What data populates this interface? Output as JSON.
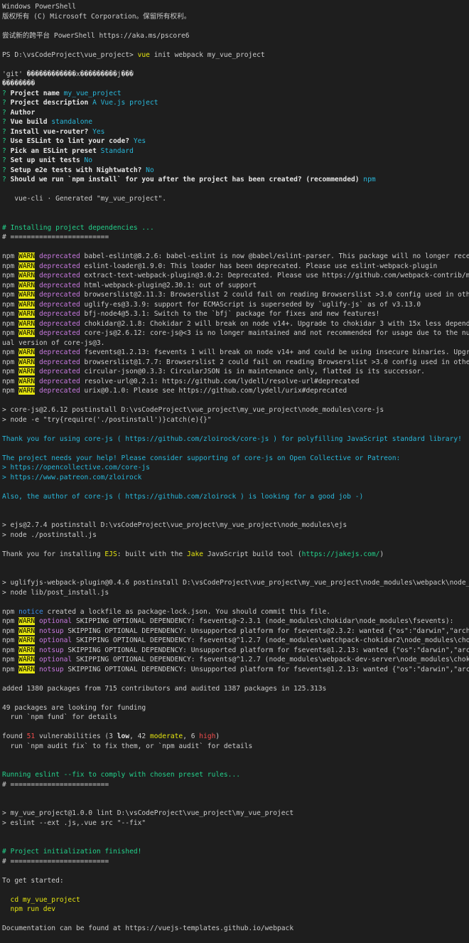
{
  "lines": [
    [
      {
        "t": "Windows PowerShell"
      }
    ],
    [
      {
        "t": "版权所有 (C) Microsoft Corporation。保留所有权利。"
      }
    ],
    [],
    [
      {
        "t": "尝试新的跨平台 PowerShell https://aka.ms/pscore6"
      }
    ],
    [],
    [
      {
        "t": "PS D:\\vsCodeProject\\vue_project> "
      },
      {
        "t": "vue",
        "c": "yellow"
      },
      {
        "t": " init webpack my_vue_project"
      }
    ],
    [],
    [
      {
        "t": "'git' ������������x���������j���"
      }
    ],
    [
      {
        "t": "��������"
      }
    ],
    [
      {
        "t": "? ",
        "c": "green"
      },
      {
        "t": "Project name ",
        "c": "bold"
      },
      {
        "t": "my_vue_project",
        "c": "cyan"
      }
    ],
    [
      {
        "t": "? ",
        "c": "green"
      },
      {
        "t": "Project description ",
        "c": "bold"
      },
      {
        "t": "A Vue.js project",
        "c": "cyan"
      }
    ],
    [
      {
        "t": "? ",
        "c": "green"
      },
      {
        "t": "Author",
        "c": "bold"
      }
    ],
    [
      {
        "t": "? ",
        "c": "green"
      },
      {
        "t": "Vue build ",
        "c": "bold"
      },
      {
        "t": "standalone",
        "c": "cyan"
      }
    ],
    [
      {
        "t": "? ",
        "c": "green"
      },
      {
        "t": "Install vue-router? ",
        "c": "bold"
      },
      {
        "t": "Yes",
        "c": "cyan"
      }
    ],
    [
      {
        "t": "? ",
        "c": "green"
      },
      {
        "t": "Use ESLint to lint your code? ",
        "c": "bold"
      },
      {
        "t": "Yes",
        "c": "cyan"
      }
    ],
    [
      {
        "t": "? ",
        "c": "green"
      },
      {
        "t": "Pick an ESLint preset ",
        "c": "bold"
      },
      {
        "t": "Standard",
        "c": "cyan"
      }
    ],
    [
      {
        "t": "? ",
        "c": "green"
      },
      {
        "t": "Set up unit tests ",
        "c": "bold"
      },
      {
        "t": "No",
        "c": "cyan"
      }
    ],
    [
      {
        "t": "? ",
        "c": "green"
      },
      {
        "t": "Setup e2e tests with Nightwatch? ",
        "c": "bold"
      },
      {
        "t": "No",
        "c": "cyan"
      }
    ],
    [
      {
        "t": "? ",
        "c": "green"
      },
      {
        "t": "Should we run `npm install` for you after the project has been created? (recommended) ",
        "c": "bold"
      },
      {
        "t": "npm",
        "c": "cyan"
      }
    ],
    [],
    [
      {
        "t": "   vue-cli · Generated \"my_vue_project\"."
      }
    ],
    [],
    [],
    [
      {
        "t": "# ",
        "c": "green"
      },
      {
        "t": "Installing project dependencies ...",
        "c": "green"
      }
    ],
    [
      {
        "t": "# ========================",
        "c": "gray"
      }
    ],
    [],
    [
      {
        "t": "npm "
      },
      {
        "t": "WARN",
        "c": "warn"
      },
      {
        "t": " "
      },
      {
        "t": "deprecated",
        "c": "magenta"
      },
      {
        "t": " babel-eslint@8.2.6: babel-eslint is now @babel/eslint-parser. This package will no longer receive u"
      }
    ],
    [
      {
        "t": "npm "
      },
      {
        "t": "WARN",
        "c": "warn"
      },
      {
        "t": " "
      },
      {
        "t": "deprecated",
        "c": "magenta"
      },
      {
        "t": " eslint-loader@1.9.0: This loader has been deprecated. Please use eslint-webpack-plugin"
      }
    ],
    [
      {
        "t": "npm "
      },
      {
        "t": "WARN",
        "c": "warn"
      },
      {
        "t": " "
      },
      {
        "t": "deprecated",
        "c": "magenta"
      },
      {
        "t": " extract-text-webpack-plugin@3.0.2: Deprecated. Please use https://github.com/webpack-contrib/mini-c"
      }
    ],
    [
      {
        "t": "npm "
      },
      {
        "t": "WARN",
        "c": "warn"
      },
      {
        "t": " "
      },
      {
        "t": "deprecated",
        "c": "magenta"
      },
      {
        "t": " html-webpack-plugin@2.30.1: out of support"
      }
    ],
    [
      {
        "t": "npm "
      },
      {
        "t": "WARN",
        "c": "warn"
      },
      {
        "t": " "
      },
      {
        "t": "deprecated",
        "c": "magenta"
      },
      {
        "t": " browserslist@2.11.3: Browserslist 2 could fail on reading Browserslist >3.0 config used in other to"
      }
    ],
    [
      {
        "t": "npm "
      },
      {
        "t": "WARN",
        "c": "warn"
      },
      {
        "t": " "
      },
      {
        "t": "deprecated",
        "c": "magenta"
      },
      {
        "t": " uglify-es@3.3.9: support for ECMAScript is superseded by `uglify-js` as of v3.13.0"
      }
    ],
    [
      {
        "t": "npm "
      },
      {
        "t": "WARN",
        "c": "warn"
      },
      {
        "t": " "
      },
      {
        "t": "deprecated",
        "c": "magenta"
      },
      {
        "t": " bfj-node4@5.3.1: Switch to the `bfj` package for fixes and new features!"
      }
    ],
    [
      {
        "t": "npm "
      },
      {
        "t": "WARN",
        "c": "warn"
      },
      {
        "t": " "
      },
      {
        "t": "deprecated",
        "c": "magenta"
      },
      {
        "t": " chokidar@2.1.8: Chokidar 2 will break on node v14+. Upgrade to chokidar 3 with 15x less dependencie"
      }
    ],
    [
      {
        "t": "npm "
      },
      {
        "t": "WARN",
        "c": "warn"
      },
      {
        "t": " "
      },
      {
        "t": "deprecated",
        "c": "magenta"
      },
      {
        "t": " core-js@2.6.12: core-js@<3 is no longer maintained and not recommended for usage due to the number"
      }
    ],
    [
      {
        "t": "ual version of core-js@3."
      }
    ],
    [
      {
        "t": "npm "
      },
      {
        "t": "WARN",
        "c": "warn"
      },
      {
        "t": " "
      },
      {
        "t": "deprecated",
        "c": "magenta"
      },
      {
        "t": " fsevents@1.2.13: fsevents 1 will break on node v14+ and could be using insecure binaries. Upgrade t"
      }
    ],
    [
      {
        "t": "npm "
      },
      {
        "t": "WARN",
        "c": "warn"
      },
      {
        "t": " "
      },
      {
        "t": "deprecated",
        "c": "magenta"
      },
      {
        "t": " browserslist@1.7.7: Browserslist 2 could fail on reading Browserslist >3.0 config used in other too"
      }
    ],
    [
      {
        "t": "npm "
      },
      {
        "t": "WARN",
        "c": "warn"
      },
      {
        "t": " "
      },
      {
        "t": "deprecated",
        "c": "magenta"
      },
      {
        "t": " circular-json@0.3.3: CircularJSON is in maintenance only, flatted is its successor."
      }
    ],
    [
      {
        "t": "npm "
      },
      {
        "t": "WARN",
        "c": "warn"
      },
      {
        "t": " "
      },
      {
        "t": "deprecated",
        "c": "magenta"
      },
      {
        "t": " resolve-url@0.2.1: https://github.com/lydell/resolve-url#deprecated"
      }
    ],
    [
      {
        "t": "npm "
      },
      {
        "t": "WARN",
        "c": "warn"
      },
      {
        "t": " "
      },
      {
        "t": "deprecated",
        "c": "magenta"
      },
      {
        "t": " urix@0.1.0: Please see https://github.com/lydell/urix#deprecated"
      }
    ],
    [],
    [
      {
        "t": "> core-js@2.6.12 postinstall D:\\vsCodeProject\\vue_project\\my_vue_project\\node_modules\\core-js"
      }
    ],
    [
      {
        "t": "> node -e \"try{require('./postinstall')}catch(e){}\""
      }
    ],
    [],
    [
      {
        "t": "Thank you for using core-js ( https://github.com/zloirock/core-js ) for polyfilling JavaScript standard library!",
        "c": "cyan"
      }
    ],
    [],
    [
      {
        "t": "The project needs your help! Please consider supporting of core-js on Open Collective or Patreon:",
        "c": "cyan"
      }
    ],
    [
      {
        "t": "> https://opencollective.com/core-js",
        "c": "cyan"
      }
    ],
    [
      {
        "t": "> https://www.patreon.com/zloirock",
        "c": "cyan"
      }
    ],
    [],
    [
      {
        "t": "Also, the author of core-js ( https://github.com/zloirock ) is looking for a good job -)",
        "c": "cyan"
      }
    ],
    [],
    [],
    [
      {
        "t": "> ejs@2.7.4 postinstall D:\\vsCodeProject\\vue_project\\my_vue_project\\node_modules\\ejs"
      }
    ],
    [
      {
        "t": "> node ./postinstall.js"
      }
    ],
    [],
    [
      {
        "t": "Thank you for installing "
      },
      {
        "t": "EJS",
        "c": "yellow"
      },
      {
        "t": ": built with the "
      },
      {
        "t": "Jake",
        "c": "yellow"
      },
      {
        "t": " JavaScript build tool ("
      },
      {
        "t": "https://jakejs.com/",
        "c": "green"
      },
      {
        "t": ")"
      }
    ],
    [],
    [],
    [
      {
        "t": "> uglifyjs-webpack-plugin@0.4.6 postinstall D:\\vsCodeProject\\vue_project\\my_vue_project\\node_modules\\webpack\\node_modu"
      }
    ],
    [
      {
        "t": "> node lib/post_install.js"
      }
    ],
    [],
    [
      {
        "t": "npm "
      },
      {
        "t": "notice",
        "c": "notice-blue"
      },
      {
        "t": " created a lockfile as package-lock.json. You should commit this file."
      }
    ],
    [
      {
        "t": "npm "
      },
      {
        "t": "WARN",
        "c": "warn"
      },
      {
        "t": " "
      },
      {
        "t": "optional",
        "c": "magenta"
      },
      {
        "t": " SKIPPING OPTIONAL DEPENDENCY: fsevents@~2.3.1 (node_modules\\chokidar\\node_modules\\fsevents):"
      }
    ],
    [
      {
        "t": "npm "
      },
      {
        "t": "WARN",
        "c": "warn"
      },
      {
        "t": " "
      },
      {
        "t": "notsup",
        "c": "magenta"
      },
      {
        "t": " SKIPPING OPTIONAL DEPENDENCY: Unsupported platform for fsevents@2.3.2: wanted {\"os\":\"darwin\",\"arch\":\"an"
      }
    ],
    [
      {
        "t": "npm "
      },
      {
        "t": "WARN",
        "c": "warn"
      },
      {
        "t": " "
      },
      {
        "t": "optional",
        "c": "magenta"
      },
      {
        "t": " SKIPPING OPTIONAL DEPENDENCY: fsevents@^1.2.7 (node_modules\\watchpack-chokidar2\\node_modules\\chokidar"
      }
    ],
    [
      {
        "t": "npm "
      },
      {
        "t": "WARN",
        "c": "warn"
      },
      {
        "t": " "
      },
      {
        "t": "notsup",
        "c": "magenta"
      },
      {
        "t": " SKIPPING OPTIONAL DEPENDENCY: Unsupported platform for fsevents@1.2.13: wanted {\"os\":\"darwin\",\"arch\":\"a"
      }
    ],
    [
      {
        "t": "npm "
      },
      {
        "t": "WARN",
        "c": "warn"
      },
      {
        "t": " "
      },
      {
        "t": "optional",
        "c": "magenta"
      },
      {
        "t": " SKIPPING OPTIONAL DEPENDENCY: fsevents@^1.2.7 (node_modules\\webpack-dev-server\\node_modules\\chokidar\\"
      }
    ],
    [
      {
        "t": "npm "
      },
      {
        "t": "WARN",
        "c": "warn"
      },
      {
        "t": " "
      },
      {
        "t": "notsup",
        "c": "magenta"
      },
      {
        "t": " SKIPPING OPTIONAL DEPENDENCY: Unsupported platform for fsevents@1.2.13: wanted {\"os\":\"darwin\",\"arch\":\"a"
      }
    ],
    [],
    [
      {
        "t": "added 1380 packages from 715 contributors and audited 1387 packages in 125.313s"
      }
    ],
    [],
    [
      {
        "t": "49 packages are looking for funding"
      }
    ],
    [
      {
        "t": "  run `npm fund` for details"
      }
    ],
    [],
    [
      {
        "t": "found "
      },
      {
        "t": "51",
        "c": "red"
      },
      {
        "t": " vulnerabilities (3 "
      },
      {
        "t": "low",
        "c": "bold"
      },
      {
        "t": ", 42 "
      },
      {
        "t": "moderate",
        "c": "yellow"
      },
      {
        "t": ", 6 "
      },
      {
        "t": "high",
        "c": "red"
      },
      {
        "t": ")"
      }
    ],
    [
      {
        "t": "  run `npm audit fix` to fix them, or `npm audit` for details"
      }
    ],
    [],
    [],
    [
      {
        "t": "Running eslint --fix to comply with chosen preset rules...",
        "c": "green"
      }
    ],
    [
      {
        "t": "# ========================",
        "c": "gray"
      }
    ],
    [],
    [],
    [
      {
        "t": "> my_vue_project@1.0.0 lint D:\\vsCodeProject\\vue_project\\my_vue_project"
      }
    ],
    [
      {
        "t": "> eslint --ext .js,.vue src \"--fix\""
      }
    ],
    [],
    [],
    [
      {
        "t": "# ",
        "c": "green"
      },
      {
        "t": "Project initialization finished!",
        "c": "green"
      }
    ],
    [
      {
        "t": "# ========================",
        "c": "gray"
      }
    ],
    [],
    [
      {
        "t": "To get started:"
      }
    ],
    [],
    [
      {
        "t": "  cd my_vue_project",
        "c": "yellow"
      }
    ],
    [
      {
        "t": "  npm run dev",
        "c": "yellow"
      }
    ],
    [],
    [
      {
        "t": "Documentation can be found at https://vuejs-templates.github.io/webpack"
      }
    ]
  ],
  "colors": {
    "background": "#1e1e1e",
    "foreground": "#cccccc",
    "warn_bg": "#e5e510",
    "cyan": "#29b8db",
    "green": "#23d18b",
    "yellow": "#e5e510",
    "magenta": "#c678dd",
    "red": "#f14c4c"
  }
}
